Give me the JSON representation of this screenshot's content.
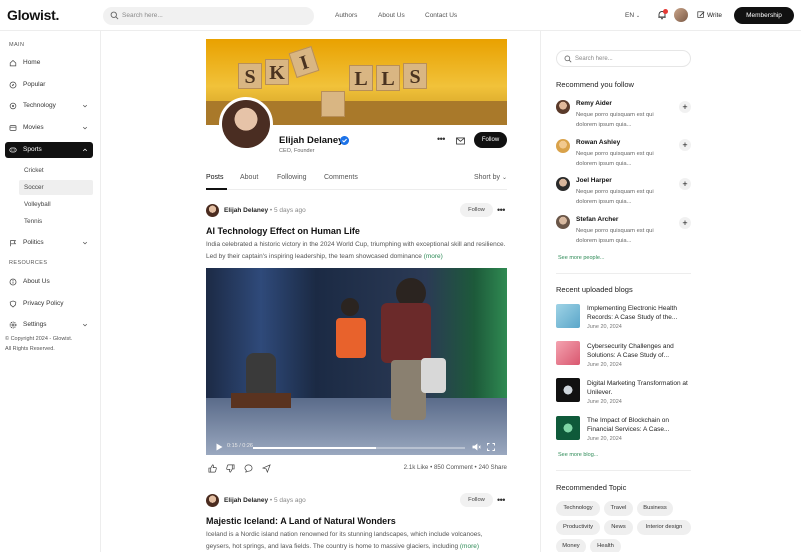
{
  "header": {
    "logo": "Glowist.",
    "search_placeholder": "Search here...",
    "nav": [
      "Authors",
      "About Us",
      "Contact Us"
    ],
    "language": "EN",
    "write_label": "Write",
    "membership_label": "Membership"
  },
  "sidebar": {
    "main_title": "MAIN",
    "items": [
      {
        "label": "Home",
        "icon": "home-icon"
      },
      {
        "label": "Popular",
        "icon": "compass-icon"
      },
      {
        "label": "Technology",
        "icon": "chip-icon"
      },
      {
        "label": "Movies",
        "icon": "film-icon"
      },
      {
        "label": "Sports",
        "icon": "sports-icon"
      },
      {
        "label": "Politics",
        "icon": "flag-icon"
      }
    ],
    "sports_sub": [
      "Cricket",
      "Soccer",
      "Volleyball",
      "Tennis"
    ],
    "resources_title": "RESOURCES",
    "resources": [
      {
        "label": "About Us",
        "icon": "info-icon"
      },
      {
        "label": "Privacy Policy",
        "icon": "shield-icon"
      },
      {
        "label": "Settings",
        "icon": "gear-icon"
      }
    ],
    "copyright_1": "© Copyright 2024 - Glowist.",
    "copyright_2": "All Rights Reserved."
  },
  "profile": {
    "banner_letters": [
      "S",
      "K",
      "I",
      "L",
      "L",
      "S"
    ],
    "name": "Elijah Delaney",
    "role": "CEO, Founder",
    "follow_label": "Follow"
  },
  "tabs": {
    "items": [
      "Posts",
      "About",
      "Following",
      "Comments"
    ],
    "sort_label": "Short by"
  },
  "posts": [
    {
      "author": "Elijah Delaney",
      "time": " • 5 days ago",
      "follow": "Follow",
      "title": "AI Technology Effect on Human Life",
      "excerpt": "India celebrated a historic victory in the 2024 World Cup, triumphing with exceptional skill and resilience. Led by their captain's inspiring leadership, the team showcased dominance",
      "more": "(more)",
      "video_time": "0:15 / 0:26",
      "video_progress": 0.58,
      "stats": "2.1k Like  •  850 Comment  •  240 Share"
    },
    {
      "author": "Elijah Delaney",
      "time": " • 5 days ago",
      "follow": "Follow",
      "title": "Majestic Iceland: A Land of Natural Wonders",
      "excerpt": "Iceland is a Nordic island nation renowned for its stunning landscapes, which include volcanoes, geysers, hot springs, and lava fields. The country is home to massive glaciers, including",
      "more": "(more)"
    }
  ],
  "right": {
    "search_placeholder": "Search here...",
    "recommend_title": "Recommend you follow",
    "people": [
      {
        "name": "Remy Aider",
        "desc": "Neque porro quisquam est qui dolorem ipsum quia..."
      },
      {
        "name": "Rowan Ashley",
        "desc": "Neque porro quisquam est qui dolorem ipsum quia..."
      },
      {
        "name": "Joel Harper",
        "desc": "Neque porro quisquam est qui dolorem ipsum quia..."
      },
      {
        "name": "Stefan Archer",
        "desc": "Neque porro quisquam est qui dolorem ipsum quia..."
      }
    ],
    "see_more_people": "See more people...",
    "blogs_title": "Recent uploaded blogs",
    "blogs": [
      {
        "title": "Implementing Electronic Health Records: A Case Study of the...",
        "date": "June 20, 2024"
      },
      {
        "title": "Cybersecurity Challenges and Solutions: A Case Study of...",
        "date": "June 20, 2024"
      },
      {
        "title": "Digital Marketing Transformation at Unilever.",
        "date": "June 20, 2024"
      },
      {
        "title": "The Impact of Blockchain on Financial Services: A Case...",
        "date": "June 20, 2024"
      }
    ],
    "see_more_blogs": "See more blog...",
    "topics_title": "Recommended Topic",
    "topics": [
      "Technology",
      "Travel",
      "Business",
      "Productivity",
      "News",
      "Interior design",
      "Money",
      "Health"
    ]
  }
}
